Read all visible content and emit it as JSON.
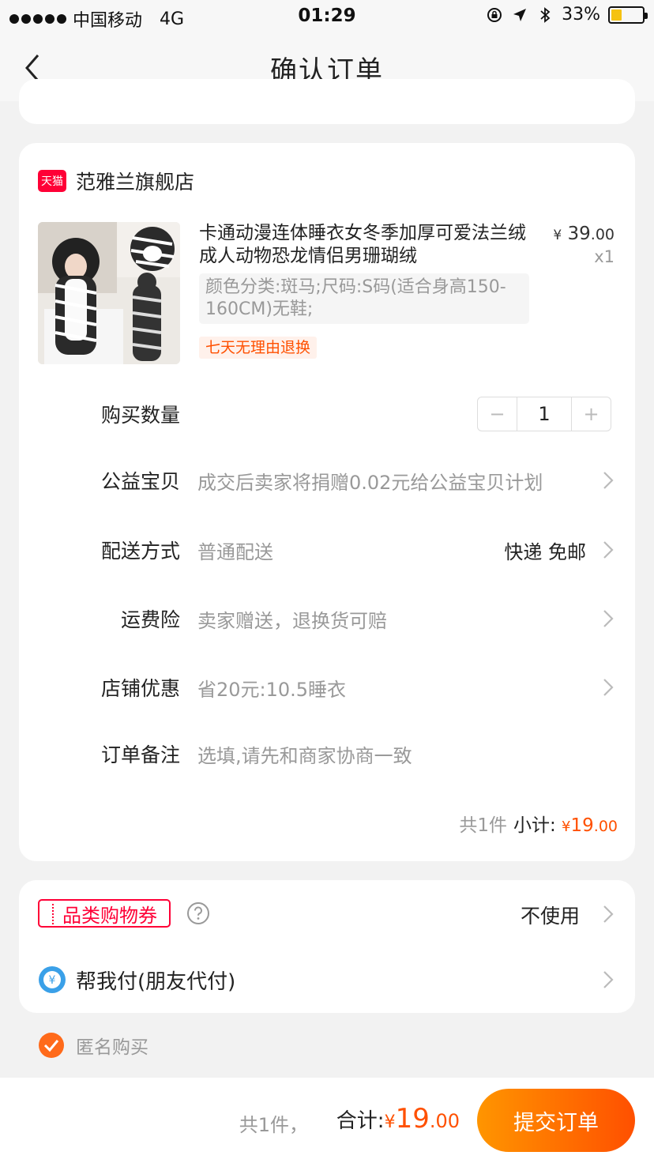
{
  "status_bar": {
    "carrier": "中国移动",
    "network": "4G",
    "time": "01:29",
    "battery": "33%",
    "battery_level": 0.33
  },
  "nav": {
    "title": "确认订单"
  },
  "shop": {
    "badge": "天猫",
    "name": "范雅兰旗舰店"
  },
  "product": {
    "title": "卡通动漫连体睡衣女冬季加厚可爱法兰绒成人动物恐龙情侣男珊瑚绒",
    "price_currency": "¥",
    "price_int": "39",
    "price_dec": ".00",
    "qty": "x1",
    "sku": "颜色分类:斑马;尺码:S码(适合身高150-160CM)无鞋;",
    "return_policy": "七天无理由退换"
  },
  "rows": {
    "quantity": {
      "label": "购买数量",
      "value": "1",
      "minus": "−",
      "plus": "+"
    },
    "charity": {
      "label": "公益宝贝",
      "value": "成交后卖家将捐赠0.02元给公益宝贝计划"
    },
    "delivery": {
      "label": "配送方式",
      "value": "普通配送",
      "right": "快递 免邮"
    },
    "insurance": {
      "label": "运费险",
      "value": "卖家赠送，退换货可赔"
    },
    "discount": {
      "label": "店铺优惠",
      "value": "省20元:10.5睡衣"
    },
    "note": {
      "label": "订单备注",
      "placeholder": "选填,请先和商家协商一致"
    }
  },
  "subtotal": {
    "count": "共1件",
    "label": "小计:",
    "currency": "¥",
    "int": "19",
    "dec": ".00"
  },
  "coupon": {
    "tag": "品类购物券",
    "value": "不使用"
  },
  "friend_pay": {
    "icon_glyph": "¥",
    "label": "帮我付(朋友代付)"
  },
  "anonymous": {
    "label": "匿名购买",
    "checked": true
  },
  "bottom": {
    "count": "共1件，",
    "total_label": "合计:",
    "currency": "¥",
    "int": "19",
    "dec": ".00",
    "submit": "提交订单"
  },
  "colors": {
    "accent": "#ff5000",
    "tmall_red": "#ff0036",
    "pay_blue": "#3aa0e8",
    "button_start": "#ff9500",
    "button_end": "#ff5000"
  }
}
